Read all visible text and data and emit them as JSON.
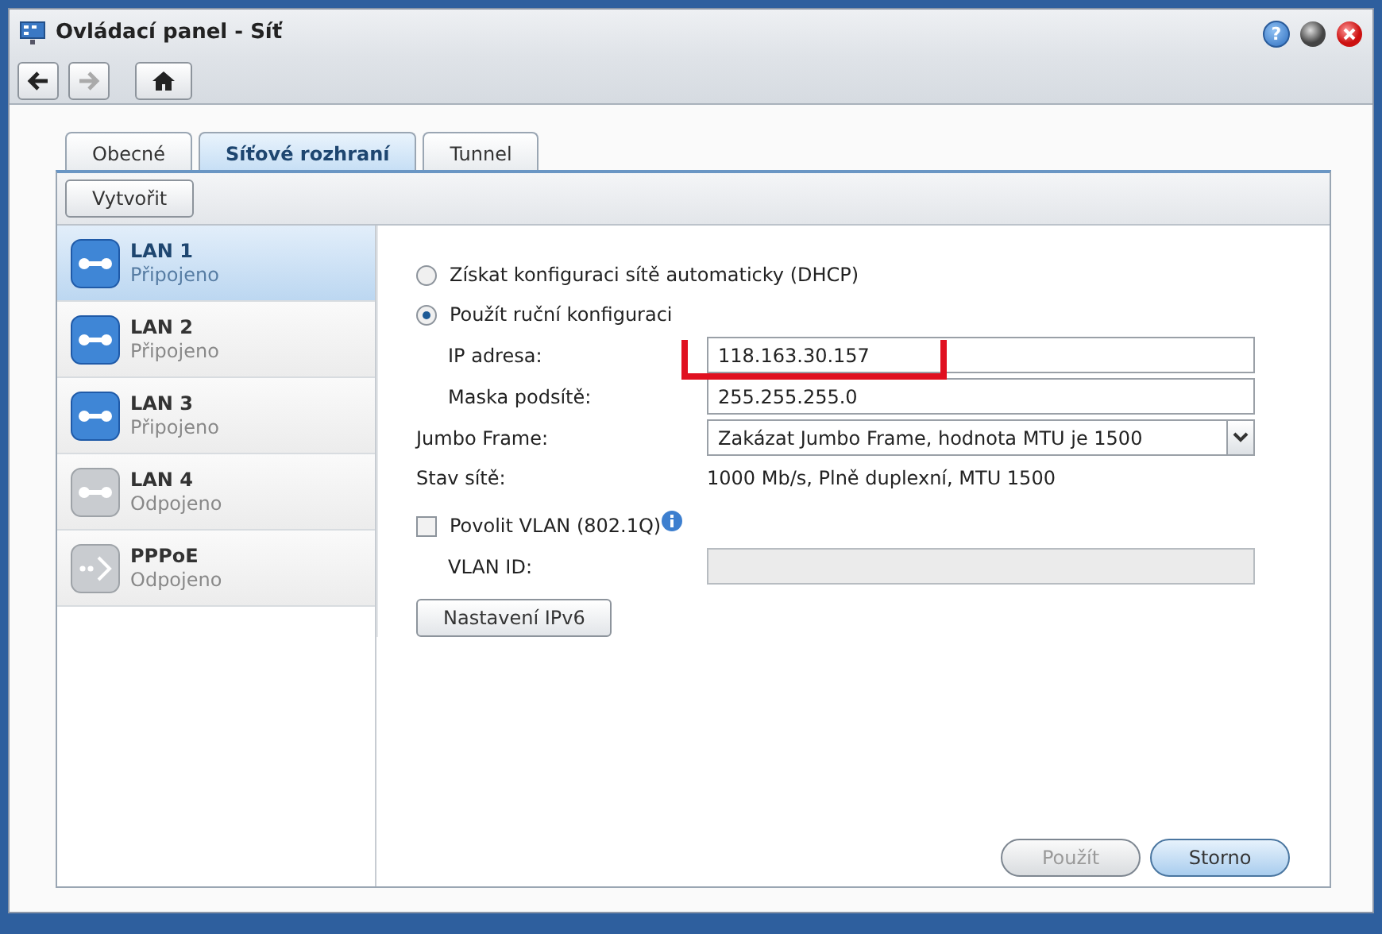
{
  "window": {
    "title": "Ovládací panel - Síť",
    "help_button": "?"
  },
  "tabs": [
    {
      "label": "Obecné",
      "selected": false
    },
    {
      "label": "Síťové rozhraní",
      "selected": true
    },
    {
      "label": "Tunnel",
      "selected": false
    }
  ],
  "create_button": "Vytvořit",
  "interfaces": [
    {
      "kind": "lan",
      "name": "LAN 1",
      "status": "Připojeno",
      "connected": true,
      "selected": true
    },
    {
      "kind": "lan",
      "name": "LAN 2",
      "status": "Připojeno",
      "connected": true,
      "selected": false
    },
    {
      "kind": "lan",
      "name": "LAN 3",
      "status": "Připojeno",
      "connected": true,
      "selected": false
    },
    {
      "kind": "lan",
      "name": "LAN 4",
      "status": "Odpojeno",
      "connected": false,
      "selected": false
    },
    {
      "kind": "pppoe",
      "name": "PPPoE",
      "status": "Odpojeno",
      "connected": false,
      "selected": false
    }
  ],
  "config_options": [
    {
      "label": "Získat konfiguraci sítě automaticky (DHCP)",
      "selected": false
    },
    {
      "label": "Použít ruční konfiguraci",
      "selected": true
    }
  ],
  "ip_label": "IP adresa:",
  "ip_value": "118.163.30.157",
  "mask_label": "Maska podsítě:",
  "mask_value": "255.255.255.0",
  "jumbo_label": "Jumbo Frame:",
  "jumbo_value": "Zakázat Jumbo Frame, hodnota MTU je 1500",
  "status_label": "Stav sítě:",
  "status_value": "1000 Mb/s, Plně duplexní, MTU 1500",
  "vlan": {
    "label": "Povolit VLAN (802.1Q)",
    "checked": false
  },
  "vlan_id_label": "VLAN ID:",
  "vlan_id_disabled": true,
  "ipv6_button": "Nastavení IPv6",
  "footer_buttons": [
    {
      "label": "Použít",
      "disabled": true,
      "primary": false
    },
    {
      "label": "Storno",
      "disabled": false,
      "primary": true
    }
  ]
}
